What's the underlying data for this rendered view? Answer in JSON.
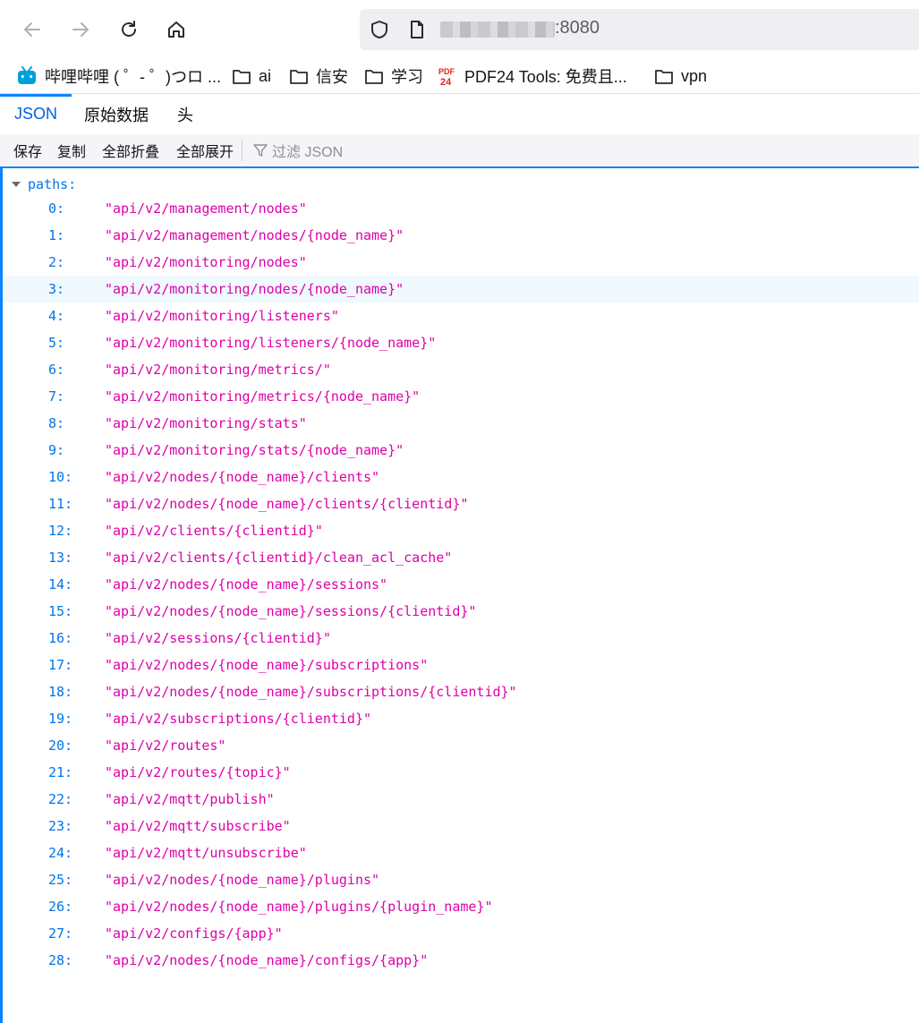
{
  "nav": {
    "url_port": ":8080"
  },
  "bookmarks": [
    {
      "label": "哔哩哔哩 ( ゜- ゜)つロ ...",
      "icon": "bilibili-icon"
    },
    {
      "label": "ai",
      "icon": "folder-icon"
    },
    {
      "label": "信安",
      "icon": "folder-icon"
    },
    {
      "label": "学习",
      "icon": "folder-icon"
    },
    {
      "label": "PDF24 Tools: 免费且...",
      "icon": "pdf24-icon"
    },
    {
      "label": "vpn",
      "icon": "folder-icon"
    }
  ],
  "tabs": [
    {
      "label": "JSON",
      "active": true
    },
    {
      "label": "原始数据",
      "active": false
    },
    {
      "label": "头",
      "active": false
    }
  ],
  "toolbar": {
    "save": "保存",
    "copy": "复制",
    "collapse_all": "全部折叠",
    "expand_all": "全部展开",
    "filter_placeholder": "过滤 JSON"
  },
  "viewer": {
    "root_key": "paths:",
    "hovered_index": 3,
    "items": [
      {
        "key": "0:",
        "value": "\"api/v2/management/nodes\""
      },
      {
        "key": "1:",
        "value": "\"api/v2/management/nodes/{node_name}\""
      },
      {
        "key": "2:",
        "value": "\"api/v2/monitoring/nodes\""
      },
      {
        "key": "3:",
        "value": "\"api/v2/monitoring/nodes/{node_name}\""
      },
      {
        "key": "4:",
        "value": "\"api/v2/monitoring/listeners\""
      },
      {
        "key": "5:",
        "value": "\"api/v2/monitoring/listeners/{node_name}\""
      },
      {
        "key": "6:",
        "value": "\"api/v2/monitoring/metrics/\""
      },
      {
        "key": "7:",
        "value": "\"api/v2/monitoring/metrics/{node_name}\""
      },
      {
        "key": "8:",
        "value": "\"api/v2/monitoring/stats\""
      },
      {
        "key": "9:",
        "value": "\"api/v2/monitoring/stats/{node_name}\""
      },
      {
        "key": "10:",
        "value": "\"api/v2/nodes/{node_name}/clients\""
      },
      {
        "key": "11:",
        "value": "\"api/v2/nodes/{node_name}/clients/{clientid}\""
      },
      {
        "key": "12:",
        "value": "\"api/v2/clients/{clientid}\""
      },
      {
        "key": "13:",
        "value": "\"api/v2/clients/{clientid}/clean_acl_cache\""
      },
      {
        "key": "14:",
        "value": "\"api/v2/nodes/{node_name}/sessions\""
      },
      {
        "key": "15:",
        "value": "\"api/v2/nodes/{node_name}/sessions/{clientid}\""
      },
      {
        "key": "16:",
        "value": "\"api/v2/sessions/{clientid}\""
      },
      {
        "key": "17:",
        "value": "\"api/v2/nodes/{node_name}/subscriptions\""
      },
      {
        "key": "18:",
        "value": "\"api/v2/nodes/{node_name}/subscriptions/{clientid}\""
      },
      {
        "key": "19:",
        "value": "\"api/v2/subscriptions/{clientid}\""
      },
      {
        "key": "20:",
        "value": "\"api/v2/routes\""
      },
      {
        "key": "21:",
        "value": "\"api/v2/routes/{topic}\""
      },
      {
        "key": "22:",
        "value": "\"api/v2/mqtt/publish\""
      },
      {
        "key": "23:",
        "value": "\"api/v2/mqtt/subscribe\""
      },
      {
        "key": "24:",
        "value": "\"api/v2/mqtt/unsubscribe\""
      },
      {
        "key": "25:",
        "value": "\"api/v2/nodes/{node_name}/plugins\""
      },
      {
        "key": "26:",
        "value": "\"api/v2/nodes/{node_name}/plugins/{plugin_name}\""
      },
      {
        "key": "27:",
        "value": "\"api/v2/configs/{app}\""
      },
      {
        "key": "28:",
        "value": "\"api/v2/nodes/{node_name}/configs/{app}\""
      }
    ]
  }
}
